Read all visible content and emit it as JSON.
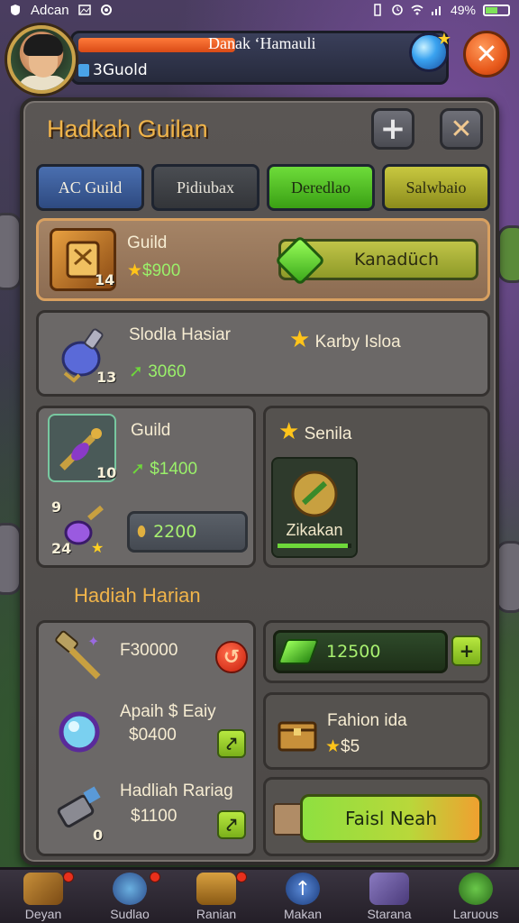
{
  "status_bar": {
    "app_name": "Adcan",
    "battery_percent": "49%",
    "battery_level": 0.49
  },
  "player": {
    "name": "Danak ʻHamauli",
    "guild": "3Guold",
    "hp_fill": 0.35
  },
  "panel": {
    "title": "Hadkah Guilan"
  },
  "tabs": [
    {
      "label": "AC Guild"
    },
    {
      "label": "Pidiubax"
    },
    {
      "label": "Deredlao"
    },
    {
      "label": "Salwbaio"
    }
  ],
  "featured": {
    "name": "Guild",
    "price": "$900",
    "qty": "14",
    "action_label": "Kanadüch"
  },
  "item_row2": {
    "name": "Slodla Hasiar",
    "price": "3060",
    "qty": "13",
    "tag": "Karby Isloa"
  },
  "item_row3": {
    "name": "Guild",
    "price": "$1400",
    "qty": "10",
    "sub_qty_top": "9",
    "sub_qty": "24",
    "sub_price": "2200",
    "side_title": "Senila",
    "side_item": "Zikakan",
    "side_progress": 0.95
  },
  "daily": {
    "title": "Hadiah Harian",
    "left_items": [
      {
        "name": "",
        "price": "F30000",
        "action": "remove"
      },
      {
        "name": "Apaih $ Eaiy",
        "price": "$0400",
        "action": "claim"
      },
      {
        "name": "Hadliah Rariag",
        "price": "$1100",
        "qty": "0",
        "action": "claim"
      }
    ],
    "right_value": "12500",
    "right_item": {
      "name": "Fahion ida",
      "price": "$5"
    },
    "cta_label": "Faisl Neah"
  },
  "bottom_nav": [
    {
      "label": "Deyan",
      "badge": true
    },
    {
      "label": "Sudlao",
      "badge": true
    },
    {
      "label": "Ranian",
      "badge": true
    },
    {
      "label": "Makan",
      "badge": false
    },
    {
      "label": "Starana",
      "badge": false
    },
    {
      "label": "Laruous",
      "badge": false
    }
  ],
  "colors": {
    "accent_title": "#f0b44a",
    "price_green": "#9af06a",
    "highlight_card": "#a58466"
  }
}
